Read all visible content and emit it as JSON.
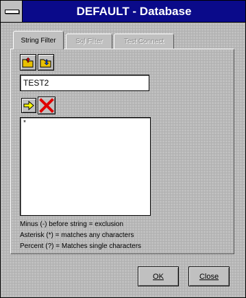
{
  "window": {
    "title": "DEFAULT - Database"
  },
  "tabs": [
    {
      "label": "String Filter",
      "active": true,
      "enabled": true
    },
    {
      "label": "Sql Filter",
      "active": false,
      "enabled": false
    },
    {
      "label": "Test Connect",
      "active": false,
      "enabled": false
    }
  ],
  "toolbar": {
    "open_icon": "folder-open-icon",
    "save_icon": "folder-save-icon",
    "add_icon": "arrow-right-icon",
    "delete_icon": "red-x-icon"
  },
  "filter_input": {
    "value": "TEST2"
  },
  "filter_list": {
    "items": [
      "*"
    ]
  },
  "help_lines": [
    "Minus (-) before string = exclusion",
    "Asterisk (*) = matches any characters",
    "Percent  (?) = Matches single characters"
  ],
  "buttons": {
    "ok_label": "OK",
    "close_label": "Close"
  },
  "colors": {
    "title_bar": "#0a0a8a",
    "delete": "#e00000",
    "arrow": "#ffff00"
  }
}
